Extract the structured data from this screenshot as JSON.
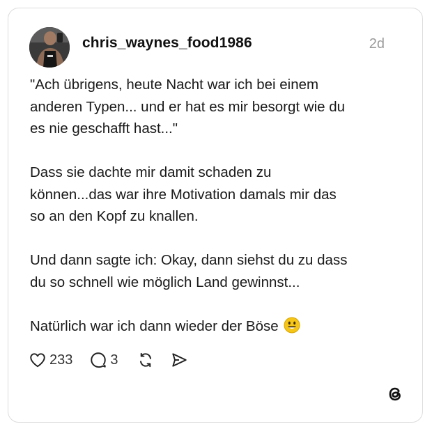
{
  "post": {
    "username": "chris_waynes_food1986",
    "timestamp": "2d",
    "paragraphs": [
      "\"Ach übrigens, heute Nacht war ich bei einem\nanderen Typen... und er hat es mir besorgt wie du\nes nie geschafft hast...\"",
      "Dass sie dachte mir damit schaden zu\nkönnen...das war ihre Motivation damals mir das\nso an den Kopf zu knallen.",
      "Und dann sagte ich: Okay, dann siehst du zu dass\ndu so schnell wie möglich Land gewinnst...",
      "Natürlich war ich dann wieder der Böse"
    ],
    "emoji": "smiling-face-emoji"
  },
  "actions": {
    "likes": "233",
    "replies": "3"
  },
  "icons": {
    "like": "heart-icon",
    "reply": "comment-bubble-icon",
    "repost": "repost-icon",
    "share": "send-icon",
    "brand": "threads-logo-icon"
  },
  "colors": {
    "text": "#1a1a1a",
    "muted": "#9a9a9a",
    "border": "#dcdcdc",
    "emoji": "#f5c518"
  }
}
